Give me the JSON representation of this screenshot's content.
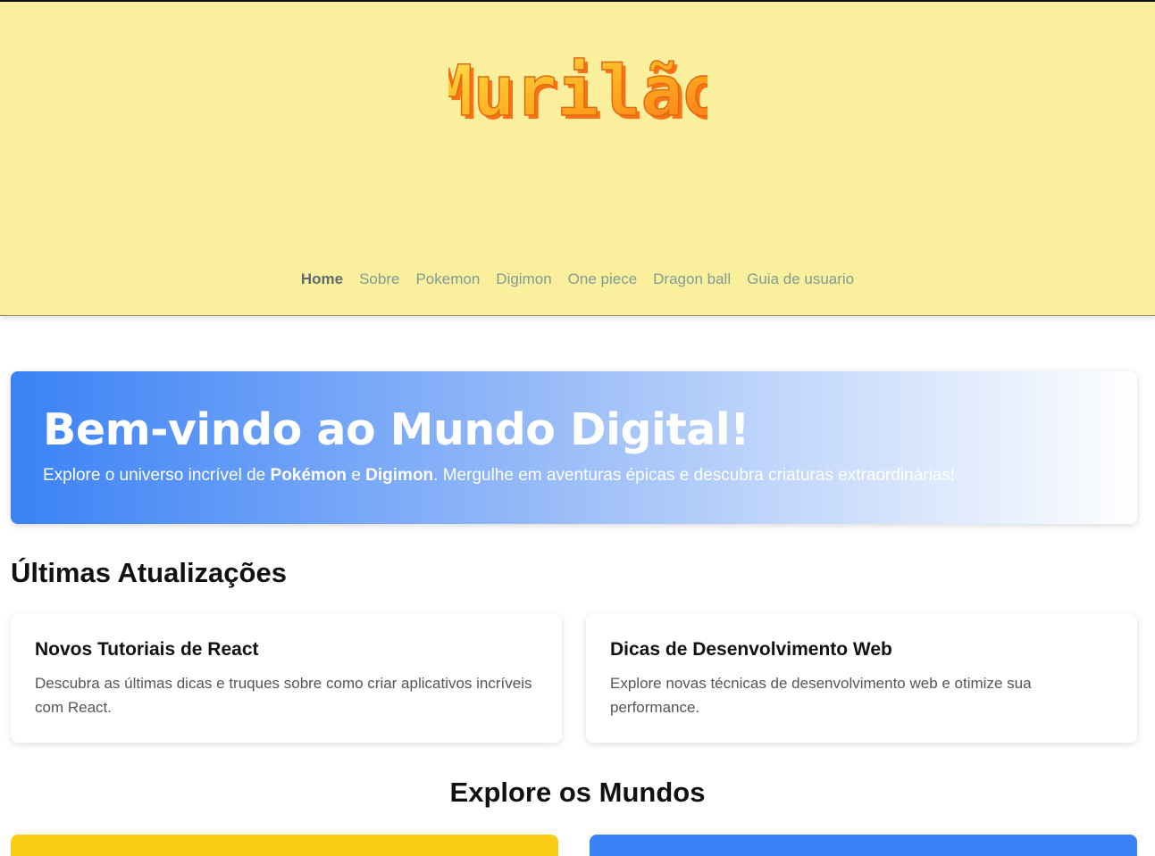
{
  "brand": {
    "logo_text": "Murilão"
  },
  "nav": {
    "items": [
      {
        "label": "Home",
        "active": true
      },
      {
        "label": "Sobre"
      },
      {
        "label": "Pokemon"
      },
      {
        "label": "Digimon"
      },
      {
        "label": "One piece"
      },
      {
        "label": "Dragon ball"
      },
      {
        "label": "Guia de usuario"
      }
    ]
  },
  "hero": {
    "title": "Bem-vindo ao Mundo Digital!",
    "text_before": "Explore o universo incrível de ",
    "pokemon": "Pokémon",
    "and": " e ",
    "digimon": "Digimon",
    "text_after": ". Mergulhe em aventuras épicas e descubra criaturas extraordinárias!"
  },
  "updates": {
    "title": "Últimas Atualizações",
    "cards": [
      {
        "title": "Novos Tutoriais de React",
        "text": "Descubra as últimas dicas e truques sobre como criar aplicativos incríveis com React."
      },
      {
        "title": "Dicas de Desenvolvimento Web",
        "text": "Explore novas técnicas de desenvolvimento web e otimize sua performance."
      }
    ]
  },
  "explore": {
    "title": "Explore os Mundos"
  },
  "colors": {
    "header_bg": "#f9ef9c",
    "nav_link": "#7f9d95",
    "hero_blue": "#3b82f6",
    "world_yellow": "#facc15",
    "world_blue": "#3b82f6"
  }
}
